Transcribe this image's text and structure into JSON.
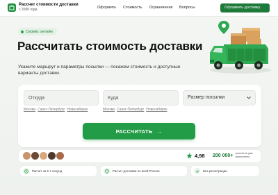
{
  "brand": {
    "title": "Рассчет стоимости доставки",
    "subtitle": "с 2000 года",
    "accent": "#239c47",
    "dark_accent": "#1e7a3a",
    "icon": "package-icon"
  },
  "nav": {
    "items": [
      "Оформить",
      "Стоимость",
      "Ограничения",
      "Вопросы"
    ],
    "cta": "Оформить доставку"
  },
  "hero": {
    "badge": "Сервис онлайн",
    "title": "Рассчитать стоимость доставки",
    "description": "Укажите маршрут и параметры посылки — покажем стоимость и доступные варианты доставки."
  },
  "form": {
    "from_placeholder": "Откуда",
    "to_placeholder": "Куда",
    "size_label": "Размер посылки",
    "from_chips": [
      "Москва",
      "Санкт-Петербург",
      "Новосибирск"
    ],
    "to_chips": [
      "Москва",
      "Санкт-Петербург",
      "Новосибирск"
    ],
    "submit": "РАССЧИТАТЬ",
    "submit_arrow": "→"
  },
  "proof": {
    "rating": "4,98",
    "count": "200 000+",
    "count_label": "расчётов уже выполнено"
  },
  "features": [
    {
      "icon": "clock-icon",
      "text": "Расчет за 5-7 секунд"
    },
    {
      "icon": "shield-icon",
      "text": "Расчет доставки по всей России"
    },
    {
      "icon": "check-icon",
      "text": "Без регистрации"
    }
  ]
}
